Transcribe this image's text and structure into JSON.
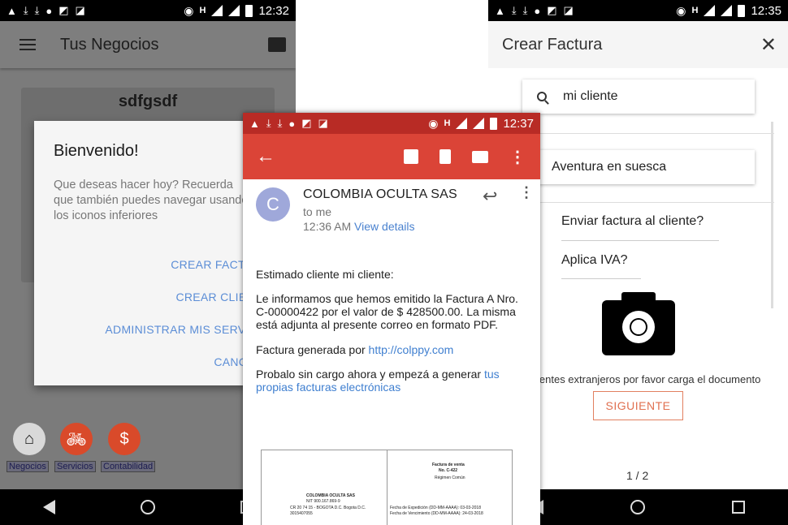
{
  "phone1": {
    "status_time": "12:32",
    "title": "Tus Negocios",
    "business_name": "sdfgsdf",
    "dialog": {
      "title": "Bienvenido!",
      "message": "Que deseas hacer hoy? Recuerda que también puedes navegar usando los iconos inferiores",
      "buttons": [
        "CREAR FACTURAS",
        "CREAR CLIENTES",
        "ADMINISTRAR MIS SERVICIOS",
        "CANCELAR"
      ]
    },
    "tabs": [
      "Negocios",
      "Servicios",
      "Contabilidad"
    ],
    "fab_icons": [
      "home-icon",
      "bicycle-icon",
      "dollar-icon"
    ]
  },
  "phone2": {
    "status_time": "12:37",
    "avatar_letter": "C",
    "sender": "COLOMBIA OCULTA SAS",
    "recipient": "to me",
    "time": "12:36 AM",
    "view_details": "View details",
    "greeting": "Estimado cliente mi cliente:",
    "paragraph1": "Le informamos que hemos emitido la Factura A Nro. C-00000422 por el valor de $ 428500.00. La misma está adjunta al presente correo en formato PDF.",
    "generated_by": "Factura generada por ",
    "generated_link": "http://colppy.com",
    "promo": "Probalo sin cargo ahora y empezá a generar ",
    "promo_link": "tus propias facturas electrónicas",
    "pdf": {
      "company": "COLOMBIA OCULTA SAS",
      "nit": "NIT 900.167.869-9",
      "address": "CR 20 74 15 - BOGOTA D.C. Bogota D.C.",
      "phone": "3015407055",
      "invoice_title": "Factura de venta",
      "invoice_no": "No. C-422",
      "regimen": "Régimen Común",
      "issue_date": "Fecha de Expedición (DD-MM-AAAA): 03-03-2018",
      "due_date": "Fecha de Vencimiento (DD-MM-AAAA): 24-03-2018"
    },
    "accent": "#db4437"
  },
  "phone3": {
    "status_time": "12:35",
    "title": "Crear Factura",
    "client_search": "mi cliente",
    "service_search": "Aventura en suesca",
    "send_label": "Enviar factura al cliente?",
    "iva_label": "Aplica IVA?",
    "doc_note": "ientes extranjeros por favor carga el documento",
    "next_button": "SIGUIENTE",
    "pager": "1 / 2",
    "accent": "#e07050"
  }
}
